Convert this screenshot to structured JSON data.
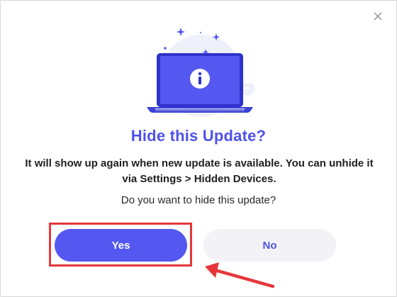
{
  "dialog": {
    "title": "Hide this Update?",
    "description": "It will show up again when new update is available. You can unhide it via Settings > Hidden Devices.",
    "question": "Do you want to hide this update?",
    "yes_label": "Yes",
    "no_label": "No",
    "close_icon": "close-icon",
    "illustration_icon": "info-icon"
  },
  "colors": {
    "accent": "#5458f0",
    "title": "#4e52e8",
    "highlight": "#e5373b",
    "secondary_button_bg": "#f3f3f7"
  }
}
